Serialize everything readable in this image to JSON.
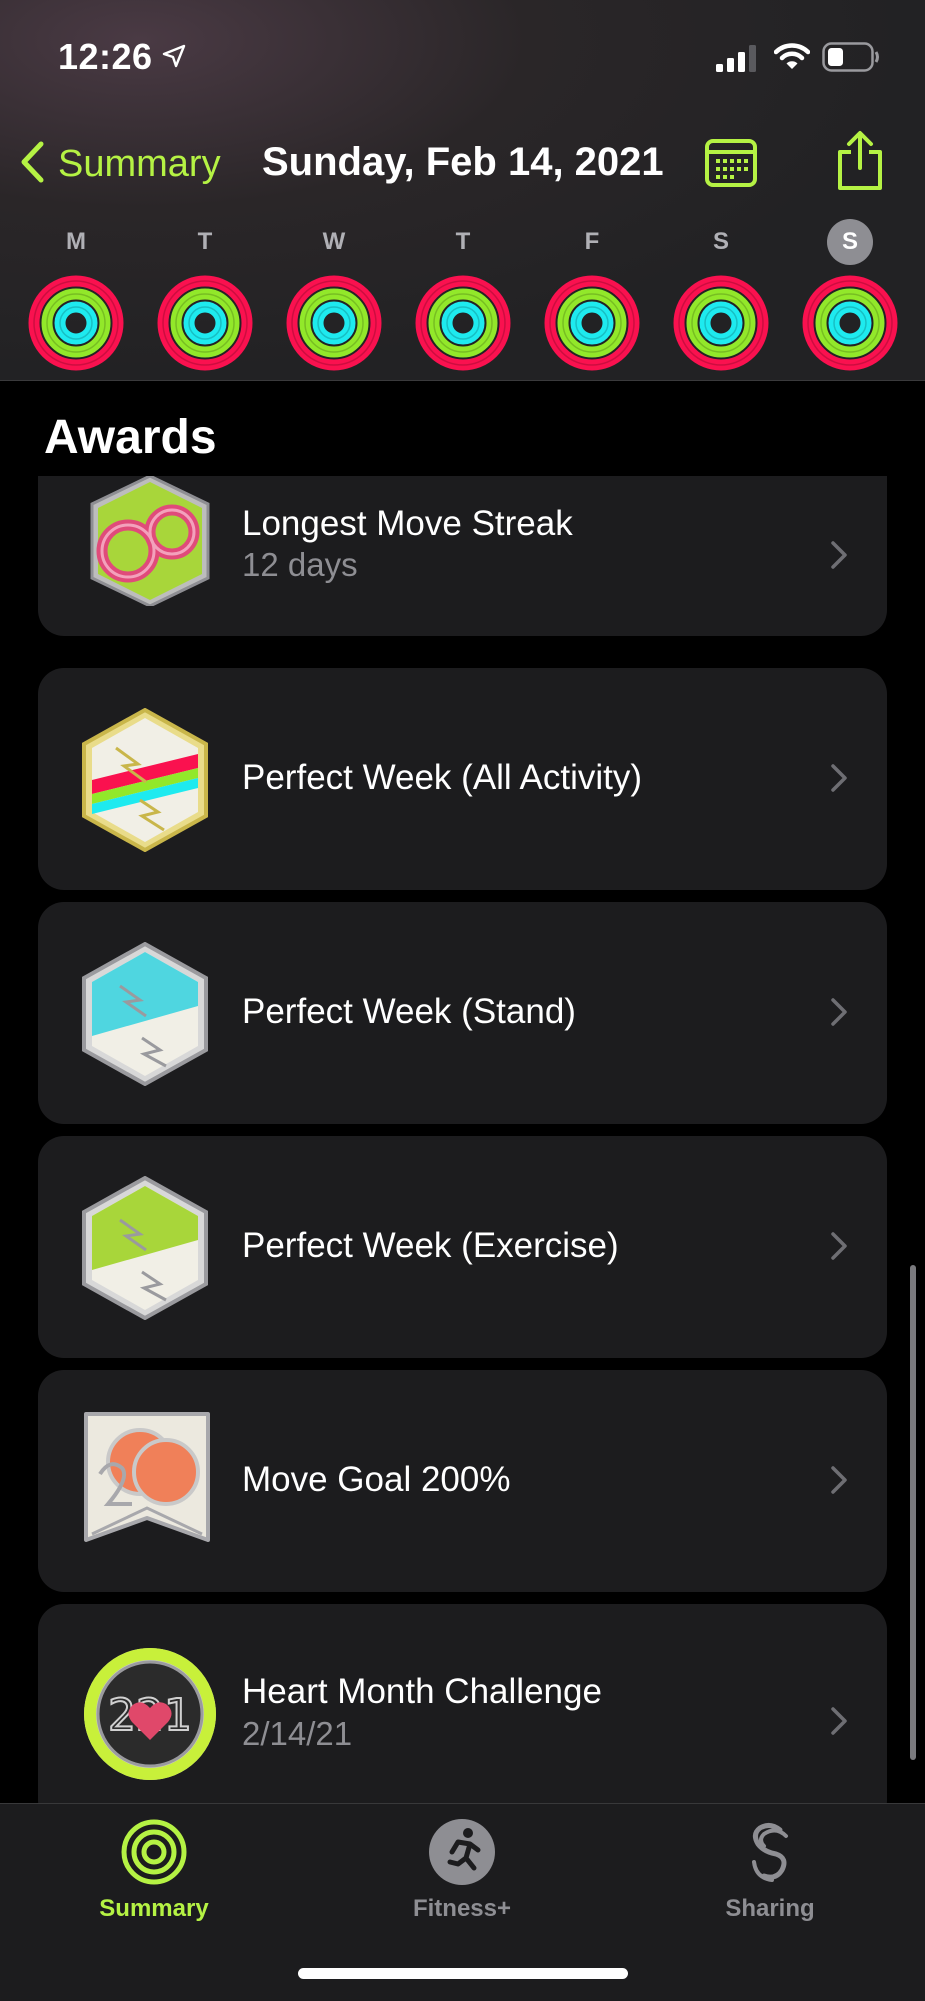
{
  "status": {
    "time": "12:26"
  },
  "nav": {
    "back_label": "Summary",
    "title": "Sunday, Feb 14, 2021",
    "calendar_icon": "calendar-icon",
    "share_icon": "share-icon"
  },
  "week": [
    {
      "letter": "M",
      "selected": false
    },
    {
      "letter": "T",
      "selected": false
    },
    {
      "letter": "W",
      "selected": false
    },
    {
      "letter": "T",
      "selected": false
    },
    {
      "letter": "F",
      "selected": false
    },
    {
      "letter": "S",
      "selected": false
    },
    {
      "letter": "S",
      "selected": true
    }
  ],
  "awards": {
    "header": "Awards",
    "items": [
      {
        "title": "Longest Move Streak",
        "subtitle": "12 days",
        "icon": "longest-move-streak-badge-icon"
      },
      {
        "title": "Perfect Week (All Activity)",
        "subtitle": "",
        "icon": "perfect-week-all-activity-badge-icon"
      },
      {
        "title": "Perfect Week (Stand)",
        "subtitle": "",
        "icon": "perfect-week-stand-badge-icon"
      },
      {
        "title": "Perfect Week (Exercise)",
        "subtitle": "",
        "icon": "perfect-week-exercise-badge-icon"
      },
      {
        "title": "Move Goal 200%",
        "subtitle": "",
        "icon": "move-goal-200-badge-icon"
      },
      {
        "title": "Heart Month Challenge",
        "subtitle": "2/14/21",
        "icon": "heart-month-challenge-badge-icon"
      }
    ]
  },
  "tabs": [
    {
      "label": "Summary",
      "active": true,
      "icon": "summary-rings-icon"
    },
    {
      "label": "Fitness+",
      "active": false,
      "icon": "fitness-plus-runner-icon"
    },
    {
      "label": "Sharing",
      "active": false,
      "icon": "sharing-icon"
    }
  ],
  "colors": {
    "accent": "#b5f244",
    "move": "#fa114f",
    "exercise": "#92e82a",
    "stand": "#1eeaef",
    "card": "#1c1c1e",
    "secondary_text": "#8e8e93"
  }
}
